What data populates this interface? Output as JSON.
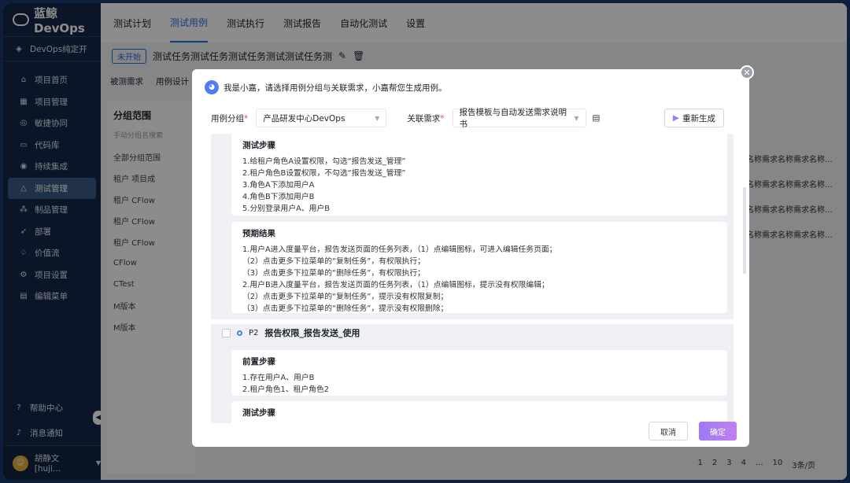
{
  "app": {
    "title": "蓝鲸 DevOps"
  },
  "sidebar": {
    "project": "DevOps纯定开",
    "items": [
      {
        "label": "项目首页",
        "icon": "home-icon"
      },
      {
        "label": "项目管理",
        "icon": "grid-icon"
      },
      {
        "label": "敏捷协同",
        "icon": "agile-icon"
      },
      {
        "label": "代码库",
        "icon": "code-icon"
      },
      {
        "label": "持续集成",
        "icon": "ci-icon"
      },
      {
        "label": "测试管理",
        "icon": "flask-icon"
      },
      {
        "label": "制品管理",
        "icon": "artifact-icon"
      },
      {
        "label": "部署",
        "icon": "rocket-icon"
      },
      {
        "label": "价值流",
        "icon": "value-icon"
      },
      {
        "label": "项目设置",
        "icon": "gear-icon"
      },
      {
        "label": "编辑菜单",
        "icon": "menu-icon"
      }
    ],
    "help": "帮助中心",
    "notify": "消息通知",
    "user": "胡静文[huji..."
  },
  "topnav": {
    "tabs": [
      "测试计划",
      "测试用例",
      "测试执行",
      "测试报告",
      "自动化测试",
      "设置"
    ],
    "active": "测试用例"
  },
  "background": {
    "status": "未开始",
    "title": "测试任务测试任务测试任务测试测试任务测",
    "subtabs": [
      "被测需求",
      "用例设计"
    ],
    "panel_title": "分组范围",
    "search_placeholder": "手动分组名搜索",
    "tree": [
      "全部分组范围",
      "租户   项目成",
      "租户   CFlow",
      "租户   CFlow",
      "租户   CFlow",
      "CFlow",
      "CTest",
      "M版本",
      "M版本"
    ],
    "rows": [
      "名称需求名称需求名称...",
      "名称需求名称需求名称...",
      "名称需求名称需求名称...",
      "名称需求名称需求名称..."
    ],
    "pager": [
      "1",
      "2",
      "3",
      "4",
      "...",
      "10",
      "3条/页"
    ]
  },
  "modal": {
    "intro": "我是小嘉，请选择用例分组与关联需求，小嘉帮您生成用例。",
    "group_label": "用例分组",
    "group_value": "产品研发中心DevOps",
    "req_label": "关联需求",
    "req_value": "报告模板与自动发送需求说明书",
    "regen_label": "重新生成",
    "steps_title": "测试步骤",
    "steps": [
      "1.给租户角色A设置权限，勾选“报告发送_管理”",
      "2.租户角色B设置权限，不勾选“报告发送_管理”",
      "3.角色A下添加用户A",
      "4.角色B下添加用户B",
      "5.分别登录用户A、用户B"
    ],
    "expected_title": "预期结果",
    "expected": [
      "1.用户A进入度量平台，报告发送页面的任务列表，（1）点编辑图标，可进入编辑任务页面；",
      "（2）点击更多下拉菜单的“复制任务”，有权限执行；",
      "（3）点击更多下拉菜单的“删除任务”，有权限执行；",
      "2.用户B进入度量平台，报告发送页面的任务列表，（1）点编辑图标，提示没有权限编辑；",
      "（2）点击更多下拉菜单的“复制任务”，提示没有权限复制；",
      "（3）点击更多下拉菜单的“删除任务”，提示没有权限删除；"
    ],
    "case2_priority": "P2",
    "case2_title": "报告权限_报告发送_使用",
    "pre_title": "前置步骤",
    "pre": [
      "1.存在用户A、用户B",
      "2.租户角色1、租户角色2"
    ],
    "steps2_title": "测试步骤",
    "cancel": "取消",
    "confirm": "确定"
  }
}
